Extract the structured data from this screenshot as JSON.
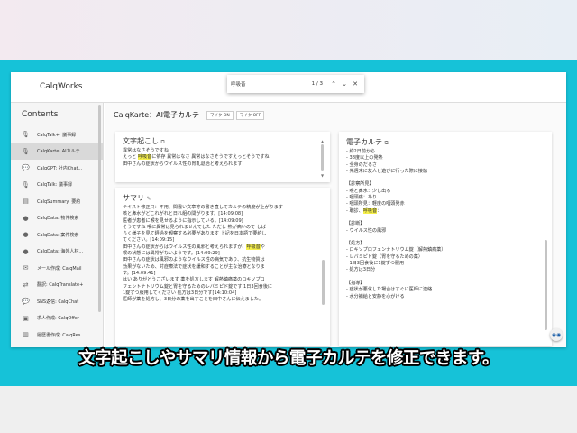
{
  "app": {
    "title": "CalqWorks"
  },
  "search": {
    "query": "呼吸音",
    "count": "1 / 3",
    "prev": "⌃",
    "next": "⌄",
    "close": "✕"
  },
  "sidebar": {
    "title": "Contents",
    "items": [
      {
        "label": "CalqTalk+: 議事録",
        "icon": "mic-icon"
      },
      {
        "label": "CalqKarte: AIカルテ",
        "icon": "mic-icon"
      },
      {
        "label": "CalqGPT: 社内Chat...",
        "icon": "chat-icon"
      },
      {
        "label": "CalqTalk: 議事録",
        "icon": "mic-icon"
      },
      {
        "label": "CalqSummary: 要約",
        "icon": "summary-icon"
      },
      {
        "label": "CalqData: 物件検索",
        "icon": "person-icon"
      },
      {
        "label": "CalqData: 案件検索",
        "icon": "person-icon"
      },
      {
        "label": "CalqData: 海外人材...",
        "icon": "person-icon"
      },
      {
        "label": "メール作成: CalqMail",
        "icon": "mail-icon"
      },
      {
        "label": "翻訳: CalqTranslate+",
        "icon": "translate-icon"
      },
      {
        "label": "SNS返信: CalqChat",
        "icon": "chat-icon"
      },
      {
        "label": "求人作成: CalqOffer",
        "icon": "briefcase-icon"
      },
      {
        "label": "履歴書作成: CalqRes...",
        "icon": "document-icon"
      }
    ]
  },
  "page": {
    "title": "CalqKarte：AI電子カルテ",
    "mic_on": "マイク ON",
    "mic_off": "マイク OFF"
  },
  "transcript": {
    "title": "文字起こし",
    "line1": "異常はなさそうですね",
    "line2a": "えっと ",
    "line2hl": "呼吸音",
    "line2b": "に依存 異常はなさ 異常はなさそうですえっとそうですね",
    "line3": "田中さんの症状からウイルス性の胃軋退治と考えられます"
  },
  "summary": {
    "title": "サマリ",
    "l1": "テキスト修正只：不用、間違い文章等の書き直してカルテの精度が上がります",
    "l2": "咳と鼻水がどこれがれと日れ組の間がります。[14:09:08]",
    "l3": "医者が患者に喉を見せるように指示している。[14:09:09]",
    "l4": "そうですね 喉に異常は見られませんでした ただし 熱が高いので しば",
    "l5": "らく様子を見て経過を観察する必要があります 上記を日本語で要約し",
    "l6": "てください。[14:09:15]",
    "l7a": "田中さんの症状からはウイルス性の風邪と考えられますが、",
    "l7hl": "呼吸音",
    "l7b": "や",
    "l8": "喉の状態には異常がないようです。[14:09:29]",
    "l9": "田中さんの症状は風邪のようなウイルス性の病気であり、抗生物質は",
    "l10": "効果がないため、対症療法で症状を緩和することが主な治療となりま",
    "l11": "す。[14:09:41]",
    "l12": "はい ありがとうございます 薬を処方します 解熱鎮痛薬のロキソプロ",
    "l13": "フェントナトリウム錠と胃を守るためのレバミピド錠です 1日3回食後に",
    "l14": "1錠ずつ服用してください 処方は3日分です[14:10:04]",
    "l15": "医師が薬を処方し、3日分の薬を出すことを田中さんに伝えました。"
  },
  "ehr": {
    "title": "電子カルテ",
    "l0": "- 約2日前から",
    "l1": "- 38度以上の発熱",
    "l2": "- 全身のだるさ",
    "l3": "- 先週末に友人と遊びに行った際に接触",
    "l4": "【診察所見】",
    "l5": "- 喉と鼻水：少し出る",
    "l6": "- 咽頭痛：あり",
    "l7": "- 咽頭所見：軽度の咽頭発赤",
    "l8a": "- 聴診、",
    "l8hl": "呼吸音",
    "l8b": "：",
    "l9": "【診断】",
    "l10": "- ウイルス性の風邪",
    "l11": "【処方】",
    "l12": "- ロキソプロフェンナトリウム錠（解熱鎮痛薬）",
    "l13": "- レバミピド錠（胃を守るための薬）",
    "l14": "- 1日3回食後に1錠ずつ服用",
    "l15": "- 処方は3日分",
    "l16": "【指導】",
    "l17": "- 症状が悪化した場合はすぐに医師に連絡",
    "l18": "- 水分補給と安静を心がける"
  },
  "caption": "文字起こしやサマリ情報から電子カルテを修正できます。",
  "colors": {
    "accent": "#16c2d8",
    "highlight": "#f5ef4a",
    "assistant": "#1b5ea8"
  }
}
